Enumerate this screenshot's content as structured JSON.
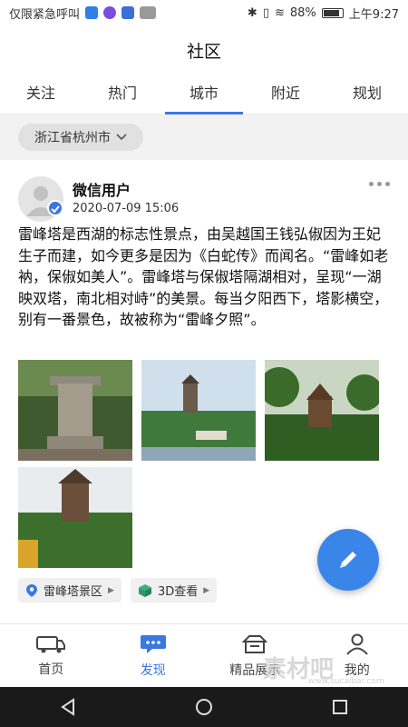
{
  "status_bar": {
    "carrier": "仅限紧急呼叫",
    "battery": "88%",
    "battery_level": 0.88,
    "time": "上午9:27"
  },
  "header": {
    "title": "社区"
  },
  "tabs": [
    {
      "label": "关注"
    },
    {
      "label": "热门"
    },
    {
      "label": "城市",
      "active": true
    },
    {
      "label": "附近"
    },
    {
      "label": "规划"
    }
  ],
  "filter": {
    "city": "浙江省杭州市"
  },
  "post": {
    "user": "微信用户",
    "time": "2020-07-09 15:06",
    "text": "雷峰塔是西湖的标志性景点，由吴越国王钱弘俶因为王妃生子而建，如今更多是因为《白蛇传》而闻名。“雷峰如老衲，保俶如美人”。雷峰塔与保俶塔隔湖相对，呈现“一湖映双塔，南北相对峙”的美景。每当夕阳西下，塔影横空，别有一番景色，故被称为“雷峰夕照”。",
    "tags": [
      {
        "label": "雷峰塔景区",
        "icon": "location-pin-icon"
      },
      {
        "label": "3D查看",
        "icon": "cube-icon"
      }
    ]
  },
  "bottom_nav": [
    {
      "label": "首页",
      "icon": "van-icon"
    },
    {
      "label": "发现",
      "icon": "chat-bubble-icon",
      "active": true
    },
    {
      "label": "精品展示",
      "icon": "box-icon"
    },
    {
      "label": "我的",
      "icon": "person-icon"
    }
  ],
  "watermark": {
    "text": "素材吧",
    "url": "www.sucaibar.com"
  },
  "colors": {
    "accent": "#3a78e0",
    "fab": "#3a86e8"
  }
}
